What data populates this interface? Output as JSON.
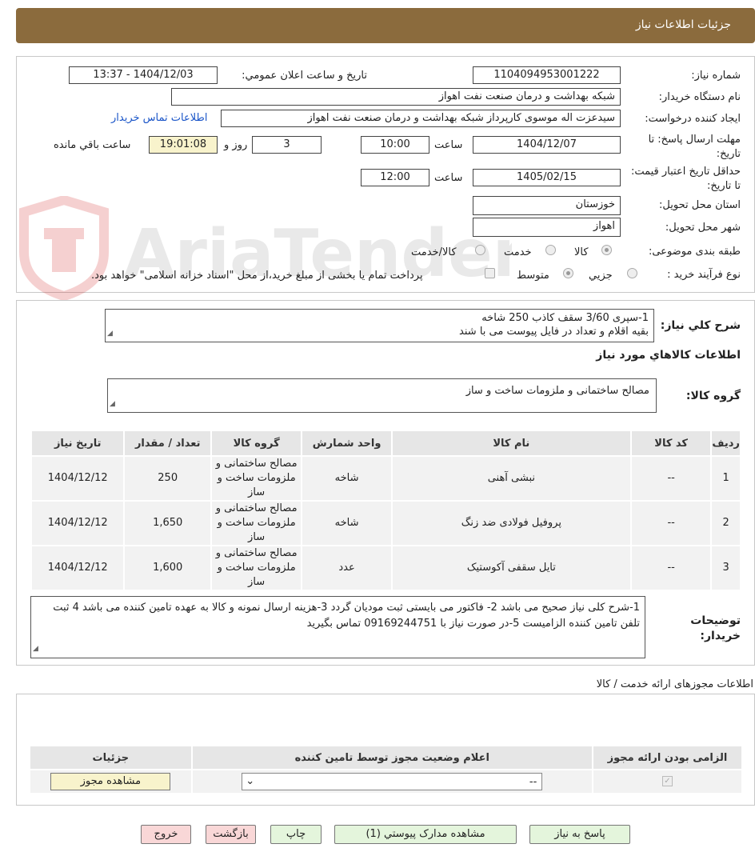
{
  "header": {
    "title": "جزئیات اطلاعات نیاز"
  },
  "watermark": {
    "text": "AriaTender.neT"
  },
  "info": {
    "need_number_label": "شماره نیاز:",
    "need_number": "1104094953001222",
    "announce_label": "تاریخ و ساعت اعلان عمومي:",
    "announce_value": "1404/12/03 - 13:37",
    "buyer_org_label": "نام دستگاه خریدار:",
    "buyer_org": "شبکه بهداشت و درمان صنعت نفت اهواز",
    "requester_label": "ایجاد کننده درخواست:",
    "requester": "سیدعزت اله موسوی کارپرداز شبکه بهداشت و درمان صنعت نفت اهواز",
    "contact_link": "اطلاعات تماس خریدار",
    "deadline_label": "مهلت ارسال پاسخ: تا تاریخ:",
    "deadline_date": "1404/12/07",
    "hour_label": "ساعت",
    "deadline_time": "10:00",
    "days": "3",
    "days_label": "روز و",
    "remaining": "19:01:08",
    "remaining_label": "ساعت باقي مانده",
    "validity_label": "حداقل تاریخ اعتبار قیمت: تا تاریخ:",
    "validity_date": "1405/02/15",
    "validity_time": "12:00",
    "province_label": "استان محل تحویل:",
    "province": "خوزستان",
    "city_label": "شهر محل تحویل:",
    "city": "اهواز",
    "category_label": "طبقه بندی موضوعی:",
    "category_options": [
      "کالا",
      "خدمت",
      "کالا/خدمت"
    ],
    "process_label": "نوع فرآیند خرید :",
    "process_options": [
      "جزیي",
      "متوسط"
    ],
    "payment_note": "پرداخت تمام یا بخشی از مبلغ خرید،از محل \"اسناد خزانه اسلامی\" خواهد بود."
  },
  "details": {
    "summary_label": "شرح کلي نیاز:",
    "summary_line1": "1-سپری 3/60 سقف کاذب 250 شاخه",
    "summary_line2": "بقیه اقلام و تعداد در فایل پیوست می با شند",
    "items_heading": "اطلاعات کالاهاي مورد نیاز",
    "group_label": "گروه کالا:",
    "group_value": "مصالح ساختمانی و ملزومات ساخت و ساز",
    "columns": [
      "ردیف",
      "کد کالا",
      "نام کالا",
      "واحد شمارش",
      "گروه کالا",
      "تعداد / مقدار",
      "تاریخ نیاز"
    ],
    "rows": [
      [
        "1",
        "--",
        "نبشی آهنی",
        "شاخه",
        "مصالح ساختمانی و ملزومات ساخت و ساز",
        "250",
        "1404/12/12"
      ],
      [
        "2",
        "--",
        "پروفیل فولادی ضد زنگ",
        "شاخه",
        "مصالح ساختمانی و ملزومات ساخت و ساز",
        "1,650",
        "1404/12/12"
      ],
      [
        "3",
        "--",
        "تایل سقفی آکوستیک",
        "عدد",
        "مصالح ساختمانی و ملزومات ساخت و ساز",
        "1,600",
        "1404/12/12"
      ]
    ],
    "notes_label": "توضیحات خریدار:",
    "notes_text": "1-شرح کلی نیاز صحیح می باشد 2- فاکتور می بایستی ثبت مودیان گردد 3-هزینه ارسال نمونه و کالا به عهده تامین کننده می باشد 4 ثبت تلفن تامین کننده الزامیست 5-در صورت نیاز با 09169244751 تماس بگیرید"
  },
  "licenses": {
    "heading": "اطلاعات مجوزهای ارائه خدمت / کالا",
    "columns": [
      "الزامی بودن ارائه مجوز",
      "اعلام وضعیت مجوز توسط تامین کننده",
      "جزئیات"
    ],
    "select_value": "--",
    "view_button": "مشاهده مجوز"
  },
  "footer": {
    "reply": "پاسخ به نیاز",
    "attachments": "مشاهده مدارک پیوستي (1)",
    "print": "چاپ",
    "back": "بازگشت",
    "exit": "خروج"
  }
}
